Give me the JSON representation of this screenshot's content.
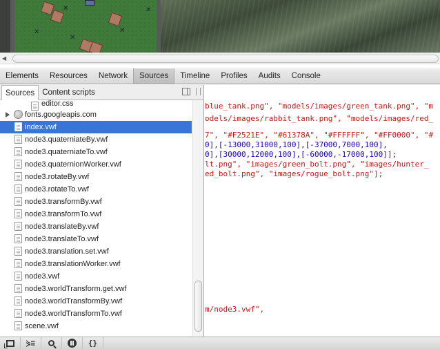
{
  "devtools_tabs": [
    {
      "label": "Elements",
      "active": false
    },
    {
      "label": "Resources",
      "active": false
    },
    {
      "label": "Network",
      "active": false
    },
    {
      "label": "Sources",
      "active": true
    },
    {
      "label": "Timeline",
      "active": false
    },
    {
      "label": "Profiles",
      "active": false
    },
    {
      "label": "Audits",
      "active": false
    },
    {
      "label": "Console",
      "active": false
    }
  ],
  "sources_panel": {
    "subtabs": [
      "Sources",
      "Content scripts"
    ],
    "files": [
      {
        "label": "editor.css",
        "kind": "css"
      },
      {
        "label": "fonts.googleapis.com",
        "kind": "domain"
      },
      {
        "label": "index.vwf",
        "kind": "file",
        "selected": true
      },
      {
        "label": "node3.quaterniateBy.vwf",
        "kind": "file"
      },
      {
        "label": "node3.quaterniateTo.vwf",
        "kind": "file"
      },
      {
        "label": "node3.quaternionWorker.vwf",
        "kind": "file"
      },
      {
        "label": "node3.rotateBy.vwf",
        "kind": "file"
      },
      {
        "label": "node3.rotateTo.vwf",
        "kind": "file"
      },
      {
        "label": "node3.transformBy.vwf",
        "kind": "file"
      },
      {
        "label": "node3.transformTo.vwf",
        "kind": "file"
      },
      {
        "label": "node3.translateBy.vwf",
        "kind": "file"
      },
      {
        "label": "node3.translateTo.vwf",
        "kind": "file"
      },
      {
        "label": "node3.translation.set.vwf",
        "kind": "file"
      },
      {
        "label": "node3.translationWorker.vwf",
        "kind": "file"
      },
      {
        "label": "node3.vwf",
        "kind": "file"
      },
      {
        "label": "node3.worldTransform.get.vwf",
        "kind": "file"
      },
      {
        "label": "node3.worldTransformBy.vwf",
        "kind": "file"
      },
      {
        "label": "node3.worldTransformTo.vwf",
        "kind": "file"
      },
      {
        "label": "scene.vwf",
        "kind": "file"
      }
    ]
  },
  "code_lines": [
    {
      "segments": [
        {
          "t": "blue_tank.png\", \"models/images/green_tank.png\", \"m",
          "c": "s"
        }
      ]
    },
    {
      "segments": [
        {
          "t": "odels/images/rabbit_tank.png\", \"models/images/red_",
          "c": "s"
        }
      ]
    },
    {
      "segments": [
        {
          "t": "",
          "c": ""
        }
      ]
    },
    {
      "segments": [
        {
          "t": "7\", \"#F2521E\", \"#61378A\", \"#FFFFFF\", \"#FF0000\", \"#",
          "c": "s"
        }
      ]
    },
    {
      "segments": [
        {
          "t": "0],[-13000,31000,100],[-37000,7000,100],",
          "c": "n"
        }
      ]
    },
    {
      "segments": [
        {
          "t": "0],[30000,12000,100],[-60000,-17000,100]];",
          "c": "n"
        }
      ]
    },
    {
      "segments": [
        {
          "t": "lt.png\", \"images/green_bolt.png\", \"images/hunter_",
          "c": "s"
        }
      ]
    },
    {
      "segments": [
        {
          "t": "ed_bolt.png\", \"images/rogue_bolt.png\"];",
          "c": "s"
        }
      ]
    },
    {
      "segments": [
        {
          "t": "m/node3.vwf\",",
          "c": "s"
        }
      ]
    }
  ],
  "status_bar": {
    "console_glyph": "⋟≡",
    "format_glyph": "{}"
  },
  "colors": {
    "selection": "#3875d7",
    "string": "#c41a16",
    "number": "#1c00cf"
  }
}
